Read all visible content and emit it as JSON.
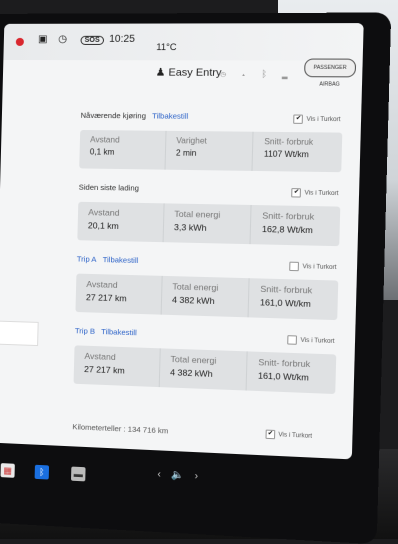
{
  "status_bar": {
    "sos": "SOS",
    "time": "10:25",
    "temperature": "11°C"
  },
  "header": {
    "easy_entry": "Easy Entry"
  },
  "airbag_badge": "PASSENGER AIRBAG",
  "sections": [
    {
      "title": "Nåværende kjøring",
      "link": "Tilbakestill",
      "checkbox_label": "Vis i Turkort",
      "checked": true,
      "cells": [
        {
          "label": "Avstand",
          "value": "0,1 km"
        },
        {
          "label": "Varighet",
          "value": "2 min"
        },
        {
          "label": "Snitt- forbruk",
          "value": "1107 Wt/km"
        }
      ]
    },
    {
      "title": "Siden siste lading",
      "link": "",
      "checkbox_label": "Vis i Turkort",
      "checked": true,
      "cells": [
        {
          "label": "Avstand",
          "value": "20,1 km"
        },
        {
          "label": "Total energi",
          "value": "3,3 kWh"
        },
        {
          "label": "Snitt- forbruk",
          "value": "162,8 Wt/km"
        }
      ]
    },
    {
      "title": "Trip A",
      "link": "Tilbakestill",
      "checkbox_label": "Vis i Turkort",
      "checked": false,
      "cells": [
        {
          "label": "Avstand",
          "value": "27 217 km"
        },
        {
          "label": "Total energi",
          "value": "4 382 kWh"
        },
        {
          "label": "Snitt- forbruk",
          "value": "161,0 Wt/km"
        }
      ]
    },
    {
      "title": "Trip B",
      "link": "Tilbakestill",
      "checkbox_label": "Vis i Turkort",
      "checked": false,
      "cells": [
        {
          "label": "Avstand",
          "value": "27 217 km"
        },
        {
          "label": "Total energi",
          "value": "4 382 kWh"
        },
        {
          "label": "Snitt- forbruk",
          "value": "161,0 Wt/km"
        }
      ]
    }
  ],
  "odometer": {
    "text": "Kilometerteller : 134 716 km",
    "checkbox_label": "Vis i Turkort",
    "checked": true
  },
  "colors": {
    "link_blue": "#2d63c8",
    "record_red": "#d9272e",
    "bluetooth_blue": "#1a6fe0"
  }
}
